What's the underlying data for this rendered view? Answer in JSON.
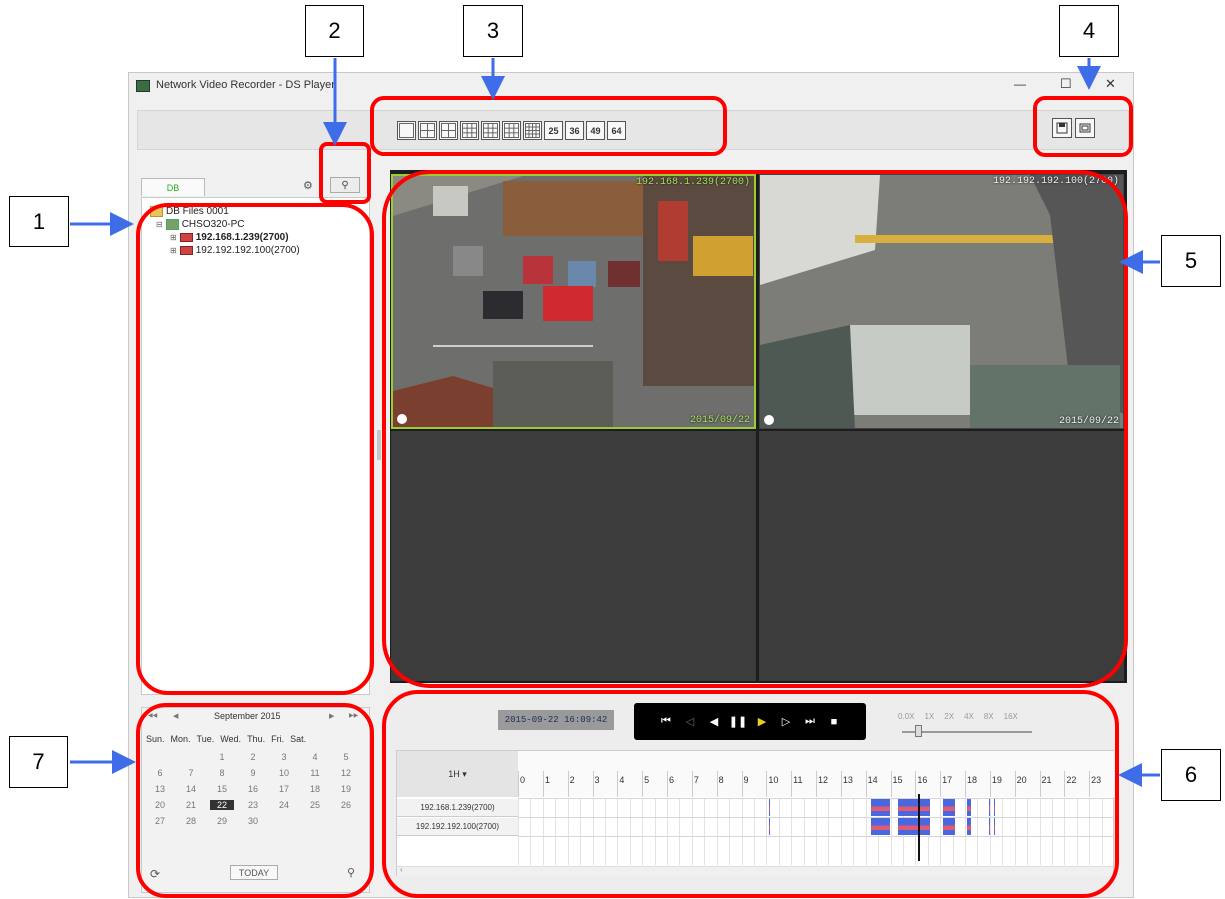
{
  "window": {
    "title": "Network Video Recorder - DS Player",
    "minimize": "—",
    "maximize": "☐",
    "close": "✕"
  },
  "toolbar": {
    "layouts": [
      "",
      "",
      "",
      "",
      "",
      "",
      "",
      "25",
      "36",
      "49",
      "64"
    ]
  },
  "left_panel": {
    "tab_label": "DB",
    "tree": {
      "root": "DB Files 0001",
      "pc": "CHSO320-PC",
      "devices": [
        "192.168.1.239(2700)",
        "192.192.192.100(2700)"
      ]
    }
  },
  "calendar": {
    "month": "September 2015",
    "nav_prev_year": "◀◀",
    "nav_prev": "◀",
    "nav_next": "▶",
    "nav_next_year": "▶▶",
    "days": [
      "Sun.",
      "Mon.",
      "Tue.",
      "Wed.",
      "Thu.",
      "Fri.",
      "Sat."
    ],
    "weeks": [
      [
        "",
        "",
        "1",
        "2",
        "3",
        "4",
        "5"
      ],
      [
        "6",
        "7",
        "8",
        "9",
        "10",
        "11",
        "12"
      ],
      [
        "13",
        "14",
        "15",
        "16",
        "17",
        "18",
        "19"
      ],
      [
        "20",
        "21",
        "22",
        "23",
        "24",
        "25",
        "26"
      ],
      [
        "27",
        "28",
        "29",
        "30",
        "",
        "",
        ""
      ]
    ],
    "selected": "22",
    "today_label": "TODAY"
  },
  "video": {
    "cam1_top": "192.168.1.239(2700)",
    "cam1_bottom": "2015/09/22",
    "cam2_top": "192.192.192.100(2700)",
    "cam2_bottom": "2015/09/22"
  },
  "playback": {
    "datetime": "2015-09-22  16:09:42",
    "speeds": [
      "0.0X",
      "1X",
      "2X",
      "4X",
      "8X",
      "16X"
    ],
    "speed_level": 0.12
  },
  "timeline": {
    "scale_label": "1H ▾",
    "hours": [
      "0",
      "1",
      "2",
      "3",
      "4",
      "5",
      "6",
      "7",
      "8",
      "9",
      "10",
      "11",
      "12",
      "13",
      "14",
      "15",
      "16",
      "17",
      "18",
      "19",
      "20",
      "21",
      "22",
      "23"
    ],
    "channels": [
      "192.168.1.239(2700)",
      "192.192.192.100(2700)"
    ],
    "cursor_hour": 16.1
  },
  "callouts": [
    "1",
    "2",
    "3",
    "4",
    "5",
    "6",
    "7"
  ],
  "colors": {
    "highlight": "#ff0000",
    "arrow": "#3f6de8",
    "record_blue": "#4a67e0",
    "record_red": "#e05a70",
    "selection": "#333333"
  }
}
